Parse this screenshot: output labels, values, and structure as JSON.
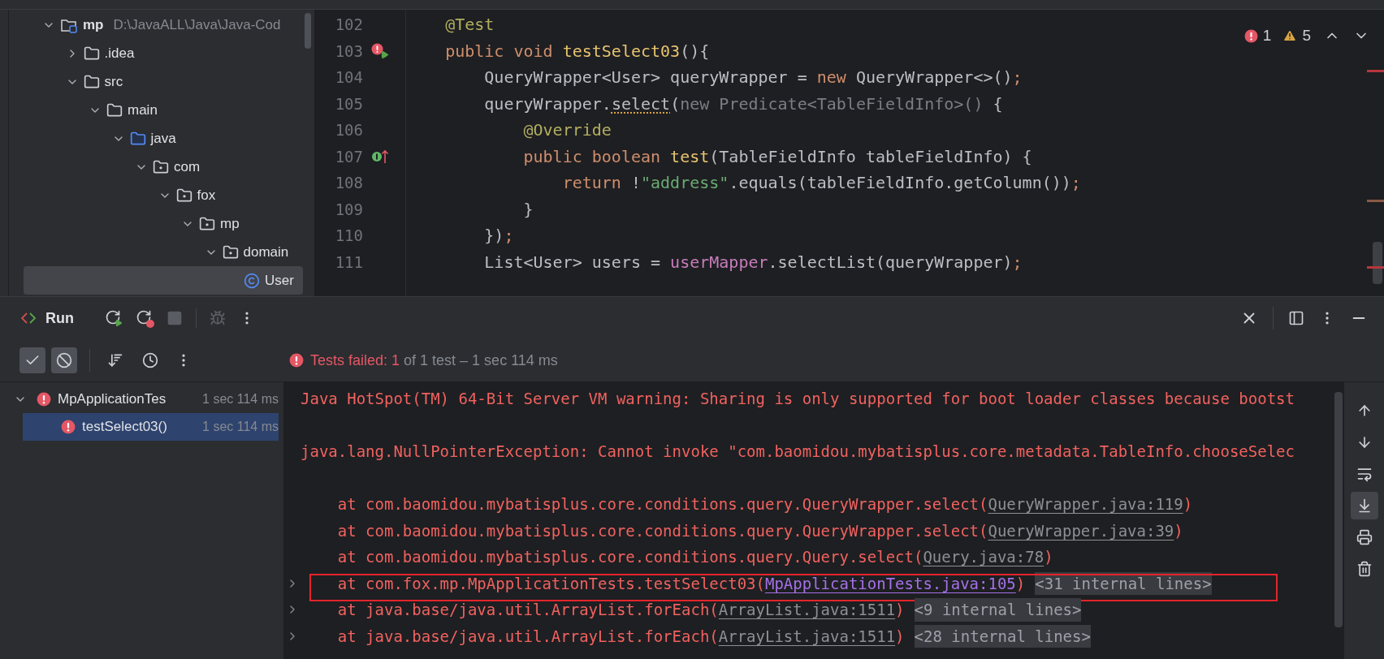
{
  "project_tree": {
    "items": [
      {
        "label": "mp",
        "path": "D:\\JavaALL\\Java\\Java-Cod",
        "kind": "module",
        "expanded": true,
        "selected": false,
        "children": [
          {
            "label": ".idea",
            "kind": "folder",
            "expanded": false,
            "selected": false
          },
          {
            "label": "src",
            "kind": "folder",
            "expanded": true,
            "selected": false,
            "children": [
              {
                "label": "main",
                "kind": "folder",
                "expanded": true,
                "selected": false,
                "children": [
                  {
                    "label": "java",
                    "kind": "source",
                    "expanded": true,
                    "selected": false,
                    "children": [
                      {
                        "label": "com",
                        "kind": "package",
                        "expanded": true,
                        "selected": false,
                        "children": [
                          {
                            "label": "fox",
                            "kind": "package",
                            "expanded": true,
                            "selected": false,
                            "children": [
                              {
                                "label": "mp",
                                "kind": "package",
                                "expanded": true,
                                "selected": false,
                                "children": [
                                  {
                                    "label": "domain",
                                    "kind": "package",
                                    "expanded": true,
                                    "selected": false,
                                    "children": [
                                      {
                                        "label": "User",
                                        "kind": "class",
                                        "selected": true
                                      }
                                    ]
                                  }
                                ]
                              }
                            ]
                          }
                        ]
                      }
                    ]
                  }
                ]
              }
            ]
          }
        ]
      }
    ]
  },
  "editor": {
    "problems": {
      "errors": "1",
      "warnings": "5"
    },
    "lines": [
      {
        "number": "102",
        "segments": [
          {
            "kind": "ann",
            "t": "    @Test"
          }
        ]
      },
      {
        "number": "103",
        "gutter": {
          "kind": "error_run"
        },
        "segments": [
          {
            "kind": "kw",
            "t": "    public void "
          },
          {
            "kind": "fn",
            "t": "testSelect03"
          },
          {
            "kind": "plain",
            "t": "(){"
          }
        ]
      },
      {
        "number": "104",
        "segments": [
          {
            "kind": "plain",
            "t": "        QueryWrapper<User> queryWrapper = "
          },
          {
            "kind": "kw",
            "t": "new "
          },
          {
            "kind": "plain",
            "t": "QueryWrapper<>()"
          },
          {
            "kind": "kw",
            "t": ";"
          }
        ]
      },
      {
        "number": "105",
        "segments": [
          {
            "kind": "plain",
            "t": "        queryWrapper."
          },
          {
            "kind": "warn",
            "t": "select"
          },
          {
            "kind": "plain",
            "t": "("
          },
          {
            "kind": "hint",
            "t": "new Predicate<TableFieldInfo>()"
          },
          {
            "kind": "plain",
            "t": " {"
          }
        ]
      },
      {
        "number": "106",
        "segments": [
          {
            "kind": "ann",
            "t": "            @Override"
          }
        ]
      },
      {
        "number": "107",
        "gutter": {
          "kind": "implements"
        },
        "segments": [
          {
            "kind": "kw",
            "t": "            public boolean "
          },
          {
            "kind": "fn",
            "t": "test"
          },
          {
            "kind": "plain",
            "t": "(TableFieldInfo tableFieldInfo) {"
          }
        ]
      },
      {
        "number": "108",
        "segments": [
          {
            "kind": "kw",
            "t": "                return "
          },
          {
            "kind": "plain",
            "t": "!"
          },
          {
            "kind": "str",
            "t": "\"address\""
          },
          {
            "kind": "plain",
            "t": ".equals(tableFieldInfo.getColumn())"
          },
          {
            "kind": "kw",
            "t": ";"
          }
        ]
      },
      {
        "number": "109",
        "segments": [
          {
            "kind": "plain",
            "t": "            }"
          }
        ]
      },
      {
        "number": "110",
        "segments": [
          {
            "kind": "plain",
            "t": "        })"
          },
          {
            "kind": "kw",
            "t": ";"
          }
        ]
      },
      {
        "number": "111",
        "segments": [
          {
            "kind": "plain",
            "t": "        List<User> users = "
          },
          {
            "kind": "field",
            "t": "userMapper"
          },
          {
            "kind": "plain",
            "t": ".selectList(queryWrapper)"
          },
          {
            "kind": "kw",
            "t": ";"
          }
        ]
      }
    ]
  },
  "run_panel": {
    "title": "Run",
    "status": {
      "failed": "Tests failed: 1",
      "detail": "of 1 test – 1 sec 114 ms"
    },
    "filters": [
      {
        "kind": "passed",
        "selected": true
      },
      {
        "kind": "ignored",
        "selected": true
      }
    ],
    "tests": [
      {
        "name": "MpApplicationTes",
        "time": "1 sec 114 ms",
        "kind": "failed",
        "expanded": true,
        "selected": false,
        "children": [
          {
            "name": "testSelect03()",
            "time": "1 sec 114 ms",
            "kind": "failed",
            "selected": true
          }
        ]
      }
    ],
    "console": {
      "blocks": [
        {
          "lines": [
            {
              "expandable": false,
              "highlighted": false,
              "segments": [
                {
                  "kind": "text",
                  "t": "Java HotSpot(TM) 64-Bit Server VM warning: Sharing is only supported for boot loader classes because bootst"
                }
              ]
            }
          ]
        },
        {
          "lines": [
            {
              "expandable": false,
              "highlighted": false,
              "segments": [
                {
                  "kind": "text",
                  "t": "java.lang.NullPointerException: Cannot invoke \"com.baomidou.mybatisplus.core.metadata.TableInfo.chooseSelec"
                }
              ]
            }
          ]
        },
        {
          "lines": [
            {
              "expandable": false,
              "highlighted": false,
              "segments": [
                {
                  "kind": "text",
                  "t": "    at com.baomidou.mybatisplus.core.conditions.query.QueryWrapper.select("
                },
                {
                  "kind": "link",
                  "t": "QueryWrapper.java:119"
                },
                {
                  "kind": "text",
                  "t": ")"
                }
              ]
            },
            {
              "expandable": false,
              "highlighted": false,
              "segments": [
                {
                  "kind": "text",
                  "t": "    at com.baomidou.mybatisplus.core.conditions.query.QueryWrapper.select("
                },
                {
                  "kind": "link",
                  "t": "QueryWrapper.java:39"
                },
                {
                  "kind": "text",
                  "t": ")"
                }
              ]
            },
            {
              "expandable": false,
              "highlighted": false,
              "segments": [
                {
                  "kind": "text",
                  "t": "    at com.baomidou.mybatisplus.core.conditions.query.Query.select("
                },
                {
                  "kind": "link",
                  "t": "Query.java:78"
                },
                {
                  "kind": "text",
                  "t": ")"
                }
              ]
            },
            {
              "expandable": true,
              "highlighted": true,
              "segments": [
                {
                  "kind": "text",
                  "t": "    at com.fox.mp.MpApplicationTests.testSelect03("
                },
                {
                  "kind": "visited",
                  "t": "MpApplicationTests.java:105"
                },
                {
                  "kind": "text",
                  "t": ")"
                },
                {
                  "kind": "folded",
                  "t": "<31 internal lines>"
                }
              ]
            },
            {
              "expandable": true,
              "highlighted": false,
              "segments": [
                {
                  "kind": "text",
                  "t": "    at java.base/java.util.ArrayList.forEach("
                },
                {
                  "kind": "link",
                  "t": "ArrayList.java:1511"
                },
                {
                  "kind": "text",
                  "t": ")"
                },
                {
                  "kind": "folded",
                  "t": "<9 internal lines>"
                }
              ]
            },
            {
              "expandable": true,
              "highlighted": false,
              "segments": [
                {
                  "kind": "text",
                  "t": "    at java.base/java.util.ArrayList.forEach("
                },
                {
                  "kind": "link",
                  "t": "ArrayList.java:1511"
                },
                {
                  "kind": "text",
                  "t": ")"
                },
                {
                  "kind": "folded",
                  "t": "<28 internal lines>"
                }
              ]
            }
          ]
        }
      ]
    },
    "console_tools": [
      {
        "kind": "up",
        "selected": false
      },
      {
        "kind": "down",
        "selected": false
      },
      {
        "kind": "wrap",
        "selected": false
      },
      {
        "kind": "scroll_end",
        "selected": true
      },
      {
        "kind": "print",
        "selected": false
      },
      {
        "kind": "clear",
        "selected": false
      }
    ]
  }
}
